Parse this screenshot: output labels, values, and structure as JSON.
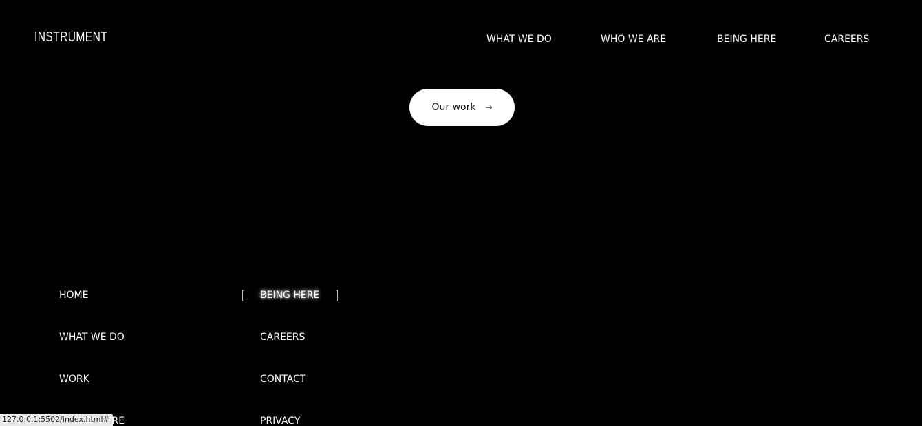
{
  "header": {
    "logo": "INSTRUMENT",
    "nav": [
      "WHAT WE DO",
      "WHO WE ARE",
      "BEING HERE",
      "CAREERS"
    ]
  },
  "hero": {
    "cta_label": "Our work",
    "cta_arrow": "→"
  },
  "footer": {
    "column_1": [
      "HOME",
      "WHAT WE DO",
      "WORK",
      "WHO WE ARE"
    ],
    "column_2": [
      "BEING HERE",
      "CAREERS",
      "CONTACT",
      "PRIVACY"
    ],
    "active_item": "BEING HERE",
    "bracket_open": "[",
    "bracket_close": "]"
  },
  "status_bar": {
    "url": "127.0.0.1:5502/index.html#"
  }
}
